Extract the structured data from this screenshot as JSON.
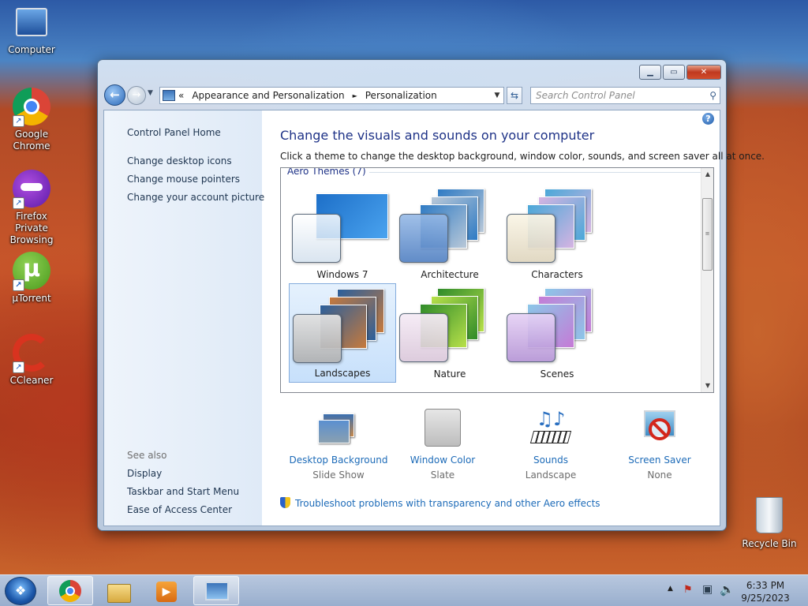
{
  "desktop": {
    "icons": [
      {
        "label": "Computer",
        "icon": "computer-icon"
      },
      {
        "label": "Google Chrome",
        "icon": "chrome-icon"
      },
      {
        "label": "Firefox Private Browsing",
        "icon": "firefox-private-icon"
      },
      {
        "label": "µTorrent",
        "icon": "utorrent-icon"
      },
      {
        "label": "CCleaner",
        "icon": "ccleaner-icon"
      },
      {
        "label": "Recycle Bin",
        "icon": "recycle-bin-icon"
      }
    ]
  },
  "window": {
    "caption_buttons": {
      "minimize": "▁",
      "maximize": "▭",
      "close": "✕"
    },
    "address": {
      "prefix": "«",
      "crumbs": [
        "Appearance and Personalization",
        "►",
        "Personalization"
      ]
    },
    "search": {
      "placeholder": "Search Control Panel"
    }
  },
  "sidebar": {
    "home": "Control Panel Home",
    "links": [
      "Change desktop icons",
      "Change mouse pointers",
      "Change your account picture"
    ],
    "see_also_label": "See also",
    "see_also": [
      "Display",
      "Taskbar and Start Menu",
      "Ease of Access Center"
    ]
  },
  "main": {
    "title": "Change the visuals and sounds on your computer",
    "subtitle": "Click a theme to change the desktop background, window color, sounds, and screen saver all at once.",
    "group_header": "Aero Themes (7)",
    "themes": [
      {
        "name": "Windows 7",
        "selected": false,
        "colors": [
          "#1d6fc8",
          "#4aa3ef"
        ]
      },
      {
        "name": "Architecture",
        "selected": false,
        "colors": [
          "#2f7bc4",
          "#b9c8d8"
        ]
      },
      {
        "name": "Characters",
        "selected": false,
        "colors": [
          "#4aa8d8",
          "#d6b4e2"
        ]
      },
      {
        "name": "Landscapes",
        "selected": true,
        "colors": [
          "#2a5f9c",
          "#c77a3c"
        ]
      },
      {
        "name": "Nature",
        "selected": false,
        "colors": [
          "#2f8b2a",
          "#b8e04a"
        ]
      },
      {
        "name": "Scenes",
        "selected": false,
        "colors": [
          "#8bc7e8",
          "#c67ad6"
        ]
      }
    ],
    "bottom_items": [
      {
        "title": "Desktop Background",
        "value": "Slide Show",
        "icon": "desktop-background-icon"
      },
      {
        "title": "Window Color",
        "value": "Slate",
        "icon": "window-color-icon"
      },
      {
        "title": "Sounds",
        "value": "Landscape",
        "icon": "sounds-icon"
      },
      {
        "title": "Screen Saver",
        "value": "None",
        "icon": "screen-saver-icon"
      }
    ],
    "troubleshoot": "Troubleshoot problems with transparency and other Aero effects"
  },
  "taskbar": {
    "pinned": [
      "chrome-icon",
      "file-explorer-icon",
      "media-player-icon",
      "control-panel-icon"
    ],
    "time": "6:33 PM",
    "date": "9/25/2023"
  }
}
